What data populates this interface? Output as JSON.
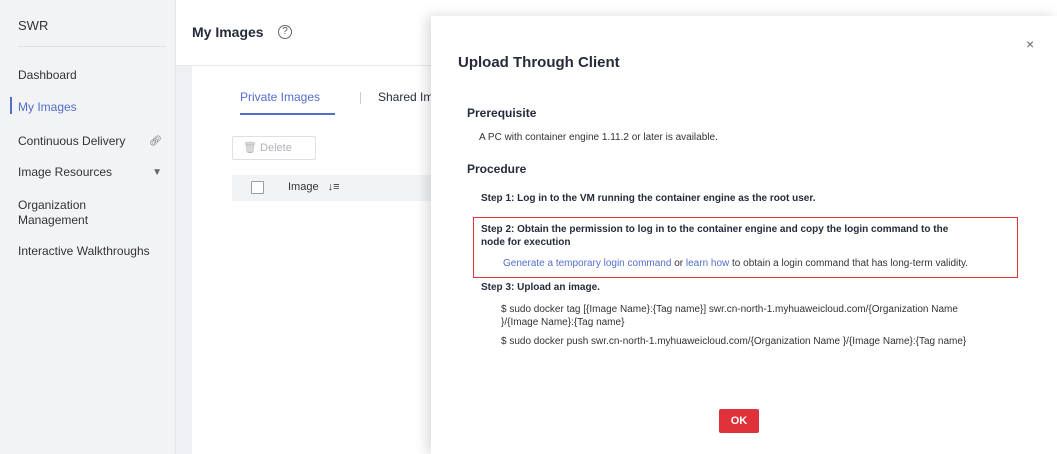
{
  "sidebar": {
    "title": "SWR",
    "items": [
      {
        "label": "Dashboard"
      },
      {
        "label": "My Images"
      },
      {
        "label": "Continuous Delivery",
        "suffix": "link-icon"
      },
      {
        "label": "Image Resources",
        "suffix": "chevron-down-icon"
      },
      {
        "label": "Organization\nManagement"
      },
      {
        "label": "Interactive Walkthroughs"
      }
    ]
  },
  "page": {
    "title": "My Images",
    "help_symbol": "?",
    "tabs": [
      {
        "label": "Private Images"
      },
      {
        "label": "Shared Ima"
      }
    ],
    "delete_label": "Delete",
    "table": {
      "columns": [
        "Image"
      ]
    }
  },
  "drawer": {
    "title": "Upload Through Client",
    "close_symbol": "×",
    "prerequisite_heading": "Prerequisite",
    "prerequisite_text": "A PC with container engine 1.11.2 or later is available.",
    "procedure_heading": "Procedure",
    "step1": "Step 1: Log in to the VM running the container engine as the root user.",
    "step2_line1": "Step 2: Obtain the permission to log in to the container engine and copy the login command to the",
    "step2_line2": "node for execution",
    "step2_link1": "Generate a temporary login command",
    "step2_or": "or",
    "step2_link2": "learn how",
    "step2_rest": "to obtain a login command that has long-term validity.",
    "step3": "Step 3: Upload an image.",
    "cmd1_line1": "$ sudo docker tag [{Image Name}:{Tag name}] swr.cn-north-1.myhuaweicloud.com/{Organization Name",
    "cmd1_line2": "}/{Image Name}:{Tag name}",
    "cmd2": "$ sudo docker push swr.cn-north-1.myhuaweicloud.com/{Organization Name }/{Image Name}:{Tag name}",
    "ok_label": "OK"
  },
  "colors": {
    "accent": "#526ecc",
    "danger": "#e0323b"
  }
}
